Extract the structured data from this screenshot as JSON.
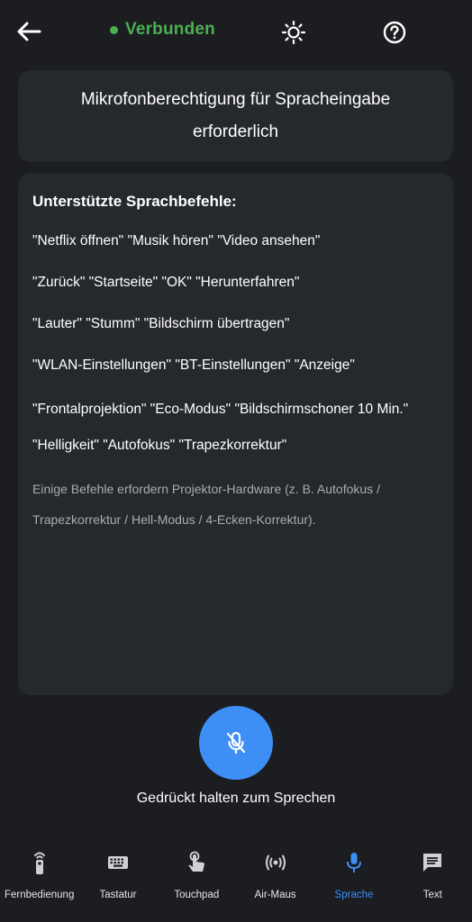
{
  "header": {
    "back_icon": "arrow-left-icon",
    "status_label": "Verbunden",
    "status_color": "#4caf50",
    "theme_icon": "sun-icon",
    "help_icon": "help-circle-icon"
  },
  "permission_card": {
    "message": "Mikrofonberechtigung für Spracheingabe erforderlich"
  },
  "commands_card": {
    "title": "Unterstützte Sprachbefehle:",
    "lines": [
      "\"Netflix öffnen\" \"Musik hören\" \"Video ansehen\"",
      "\"Zurück\" \"Startseite\" \"OK\" \"Herunterfahren\"",
      "\"Lauter\" \"Stumm\" \"Bildschirm übertragen\"",
      "\"WLAN-Einstellungen\" \"BT-Einstellungen\" \"Anzeige\"",
      "\"Frontalprojektion\" \"Eco-Modus\" \"Bildschirmschoner 10 Min.\"",
      "\"Helligkeit\" \"Autofokus\" \"Trapezkorrektur\""
    ],
    "note": "Einige Befehle erfordern Projektor-Hardware (z. B. Autofokus / Trapezkorrektur / Hell-Modus / 4-Ecken-Korrektur)."
  },
  "mic": {
    "icon": "mic-off-icon",
    "hint": "Gedrückt halten zum Sprechen",
    "accent": "#3d8ef5"
  },
  "bottom_nav": {
    "items": [
      {
        "label": "Fernbedienung",
        "icon": "remote-icon",
        "active": false
      },
      {
        "label": "Tastatur",
        "icon": "keyboard-icon",
        "active": false
      },
      {
        "label": "Touchpad",
        "icon": "touch-icon",
        "active": false
      },
      {
        "label": "Air-Maus",
        "icon": "air-mouse-icon",
        "active": false
      },
      {
        "label": "Sprache",
        "icon": "mic-icon",
        "active": true
      },
      {
        "label": "Text",
        "icon": "text-message-icon",
        "active": false
      }
    ]
  }
}
